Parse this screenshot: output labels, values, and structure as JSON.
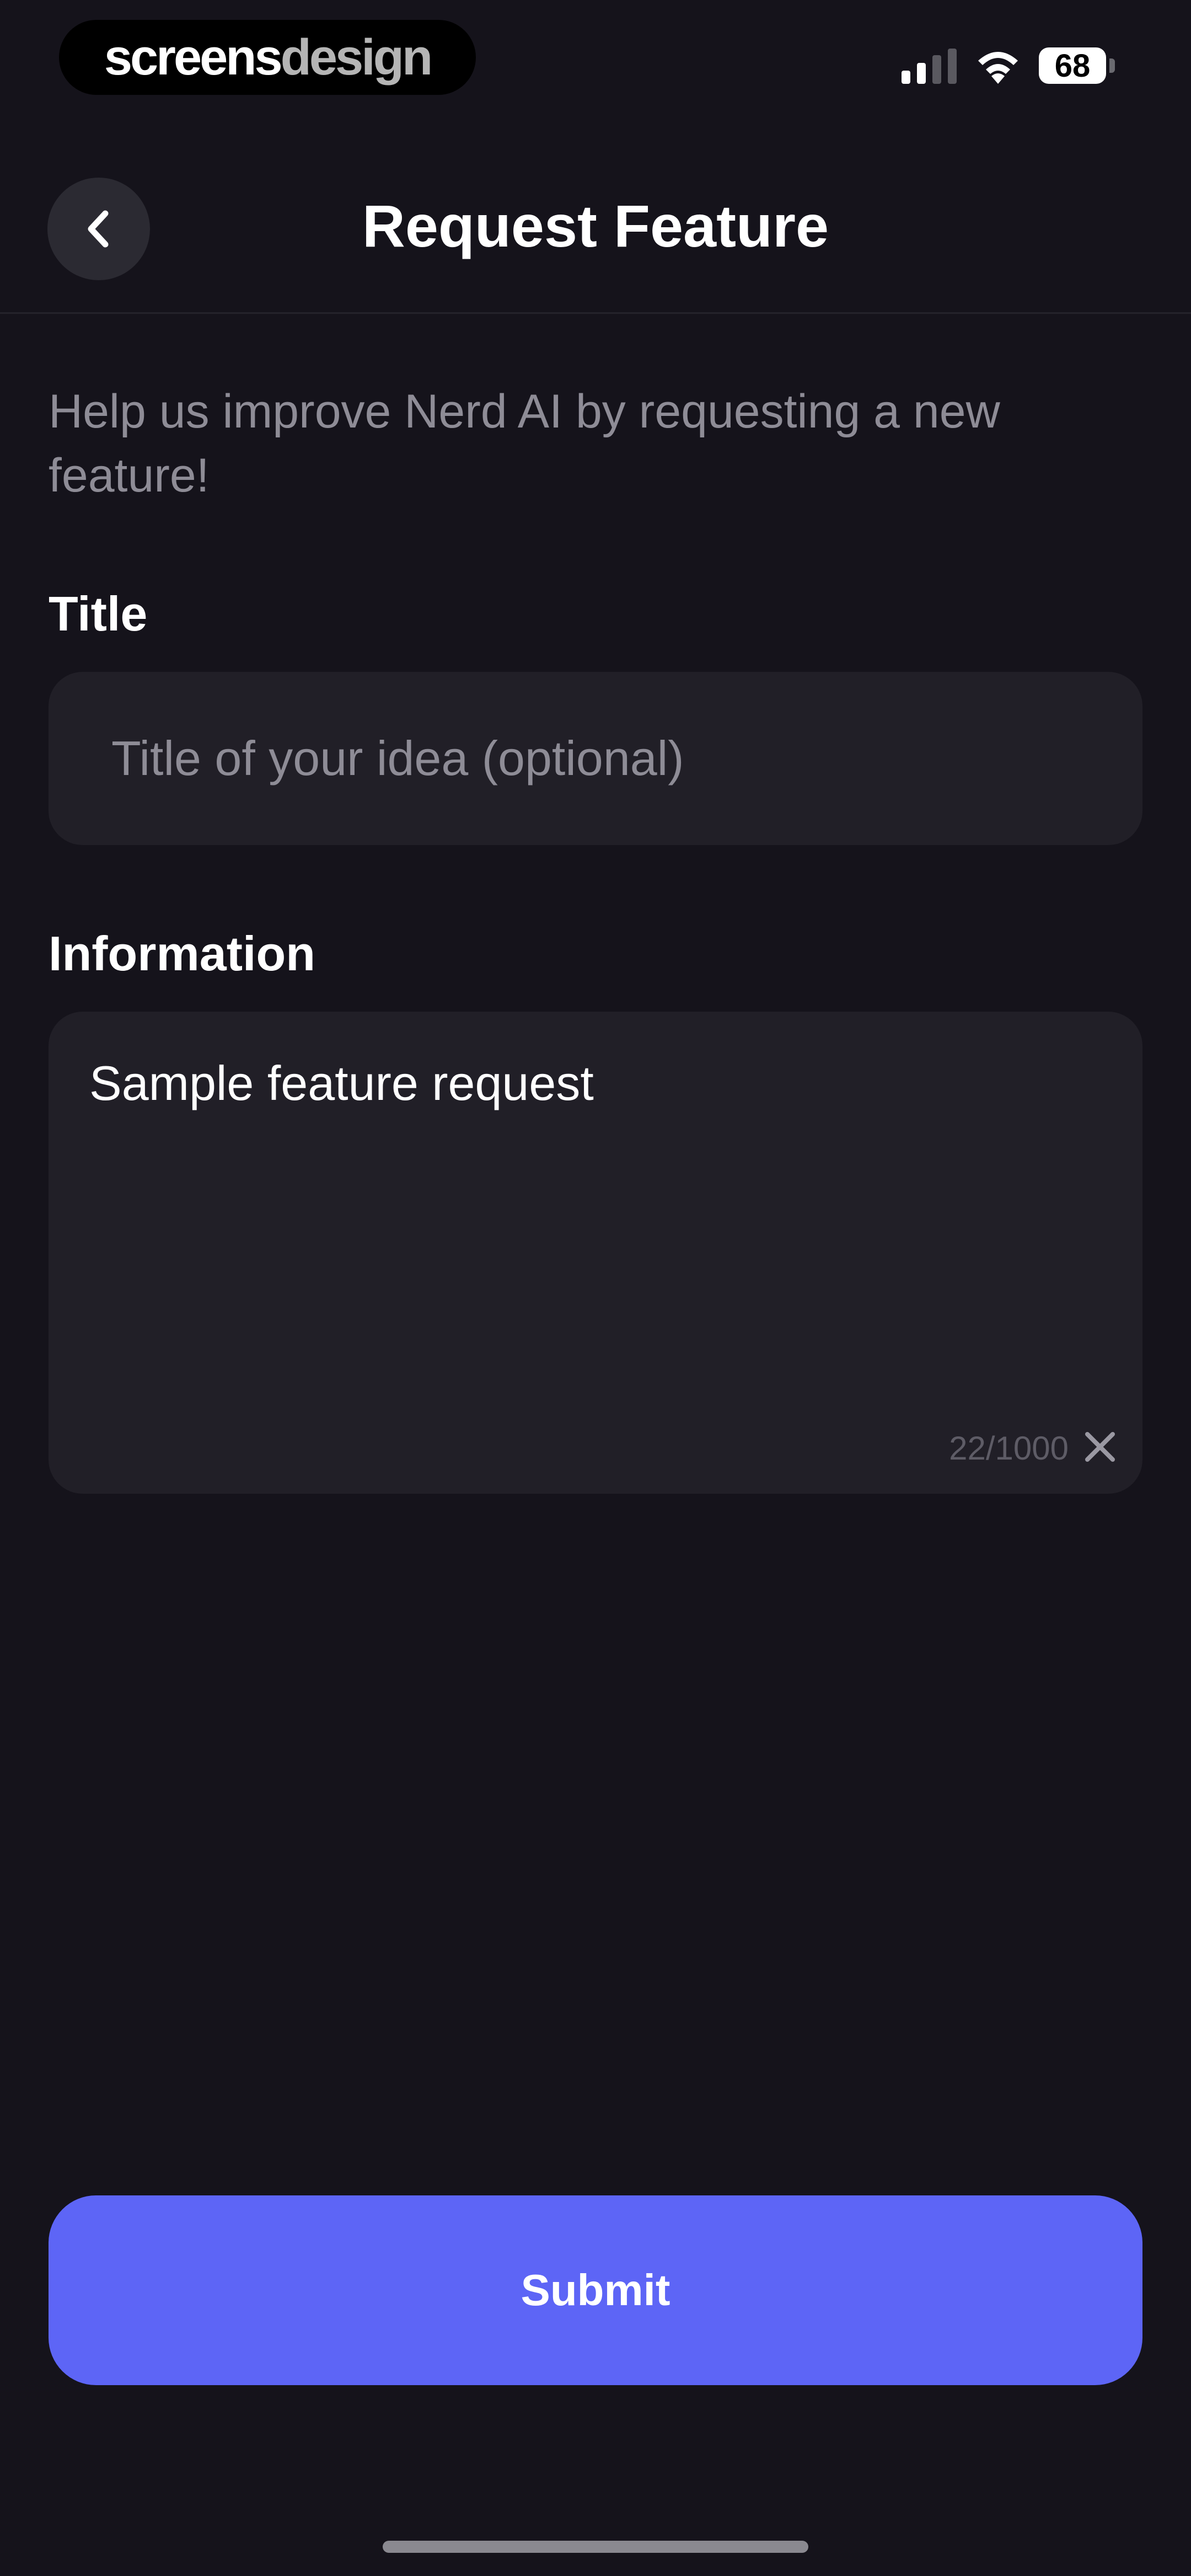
{
  "status_bar": {
    "brand_part1": "screens",
    "brand_part2": "design",
    "battery": "68"
  },
  "header": {
    "title": "Request Feature"
  },
  "intro": "Help us improve Nerd AI by requesting a new feature!",
  "form": {
    "title_label": "Title",
    "title_placeholder": "Title of your idea (optional)",
    "info_label": "Information",
    "info_value": "Sample feature request",
    "char_count": "22/1000"
  },
  "submit_label": "Submit",
  "colors": {
    "background": "#15131b",
    "field": "#211f27",
    "accent": "#5d65f6"
  },
  "icons": [
    "signal-icon",
    "wifi-icon",
    "battery-icon",
    "chevron-left-icon",
    "close-icon"
  ]
}
